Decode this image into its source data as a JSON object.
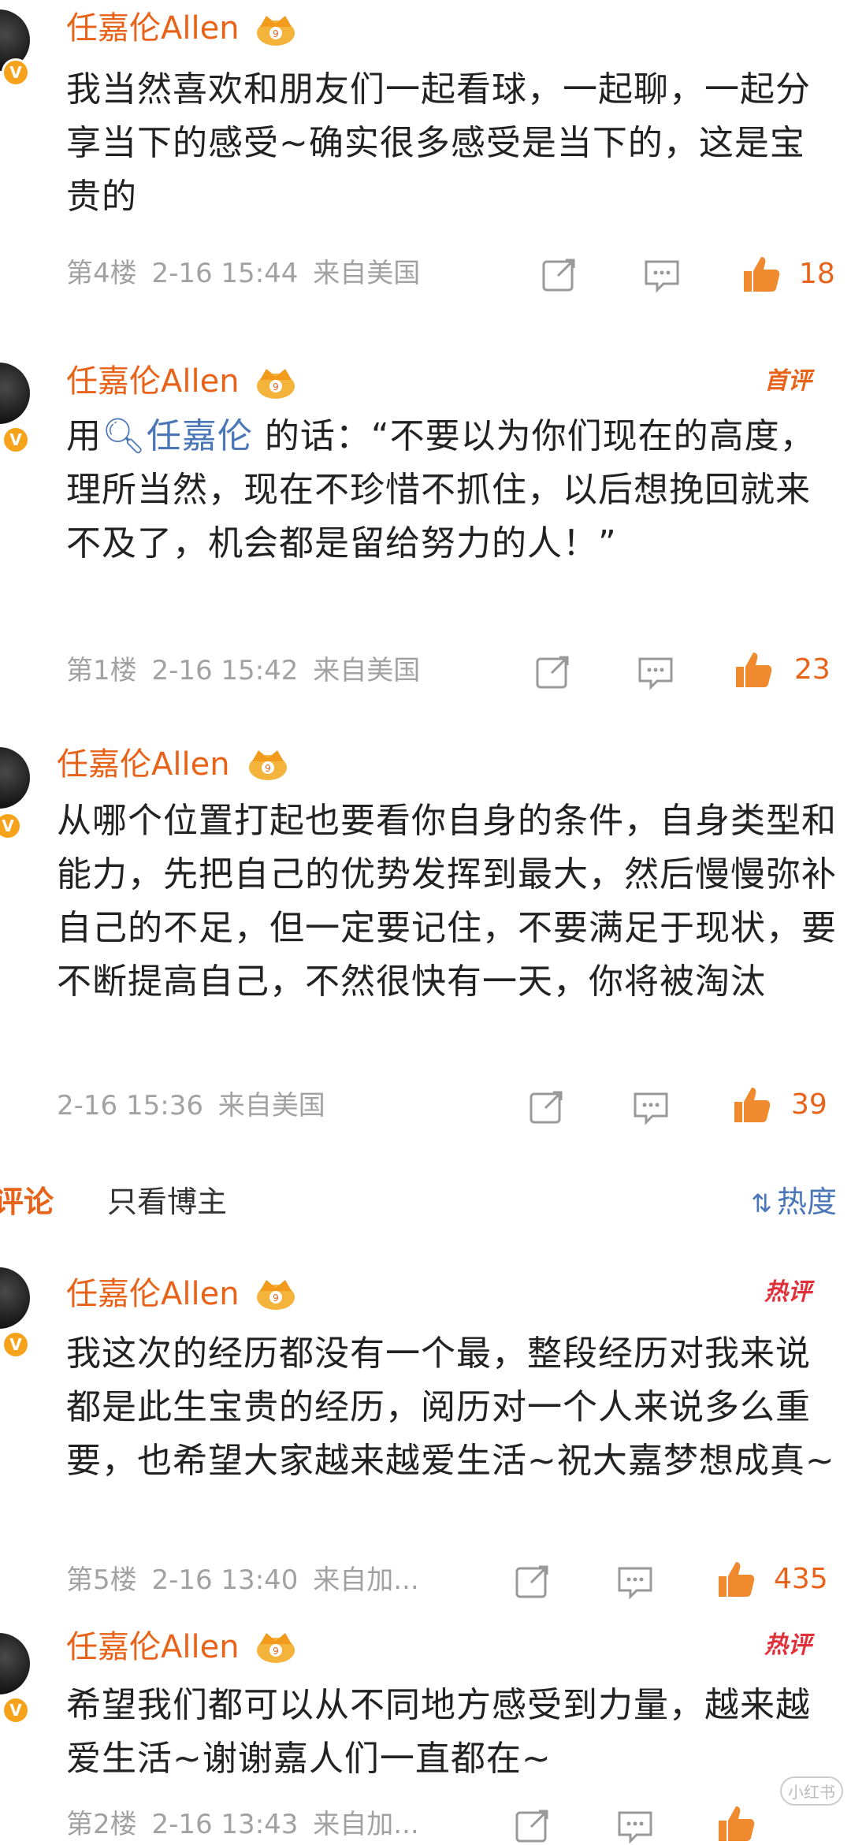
{
  "comments": [
    {
      "username": "任嘉伦Allen",
      "text": "我当然喜欢和朋友们一起看球，一起聊，一起分享当下的感受~确实很多感受是当下的，这是宝贵的",
      "floor": "第4楼",
      "time": "2-16 15:44",
      "location": "来自美国",
      "likes": "18"
    },
    {
      "username": "任嘉伦Allen",
      "tag": "首评",
      "text_prefix": "用",
      "mention": "任嘉伦",
      "text_suffix": " 的话：“不要以为你们现在的高度，理所当然，现在不珍惜不抓住，以后想挽回就来不及了，机会都是留给努力的人！”",
      "floor": "第1楼",
      "time": "2-16 15:42",
      "location": "来自美国",
      "likes": "23"
    },
    {
      "username": "任嘉伦Allen",
      "text": "从哪个位置打起也要看你自身的条件，自身类型和能力，先把自己的优势发挥到最大，然后慢慢弥补自己的不足，但一定要记住，不要满足于现状，要不断提高自己，不然很快有一天，你将被淘汰",
      "time": "2-16 15:36",
      "location": "来自美国",
      "likes": "39"
    },
    {
      "username": "任嘉伦Allen",
      "tag": "热评",
      "text": "我这次的经历都没有一个最，整段经历对我来说都是此生宝贵的经历，阅历对一个人来说多么重要，也希望大家越来越爱生活~祝大嘉梦想成真~",
      "floor": "第5楼",
      "time": "2-16 13:40",
      "location": "来自加...",
      "likes": "435"
    },
    {
      "username": "任嘉伦Allen",
      "tag": "热评",
      "text": "希望我们都可以从不同地方感受到力量，越来越爱生活~谢谢嘉人们一直都在~",
      "floor": "第2楼",
      "time": "2-16 13:43",
      "location": "来自加..."
    }
  ],
  "tabs": {
    "all": "评论",
    "owner_only": "只看博主",
    "sort": "热度"
  },
  "watermark": "小红书",
  "colors": {
    "accent": "#e8631a",
    "link": "#4b77b8",
    "meta": "#a2a2a2",
    "hot_tag": "#e0303a",
    "first_tag": "#e8631a"
  },
  "icons": [
    "repost-icon",
    "comment-icon",
    "like-icon",
    "crown-badge-icon",
    "verified-badge-icon",
    "sort-icon"
  ]
}
